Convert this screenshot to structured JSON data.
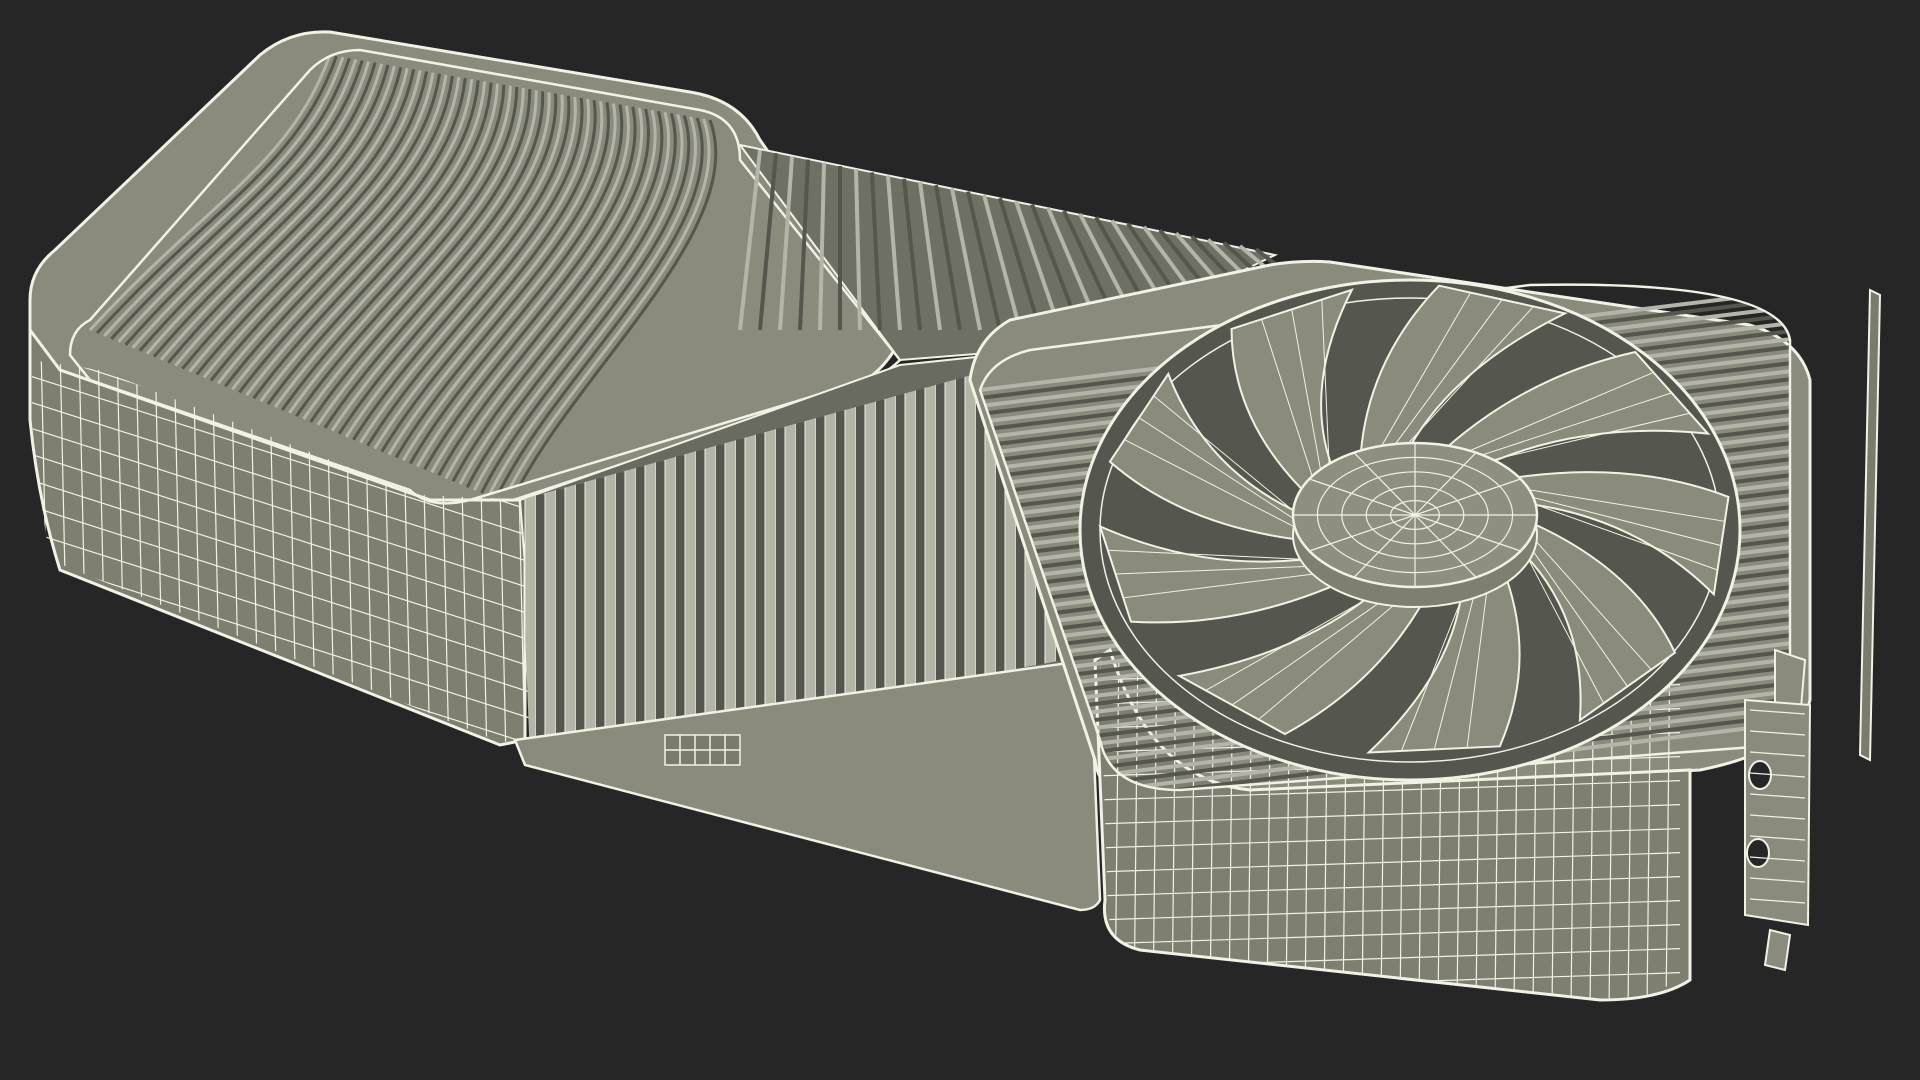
{
  "scene": {
    "background": "#262626",
    "subject": "graphics-card-wireframe",
    "colors": {
      "shell": "#8a8b7c",
      "shell_dark": "#6f7064",
      "shell_light": "#a3a497",
      "wire": "#f1f1e6",
      "fin_dark": "#55564d",
      "fin_light": "#b4b5a8"
    }
  }
}
